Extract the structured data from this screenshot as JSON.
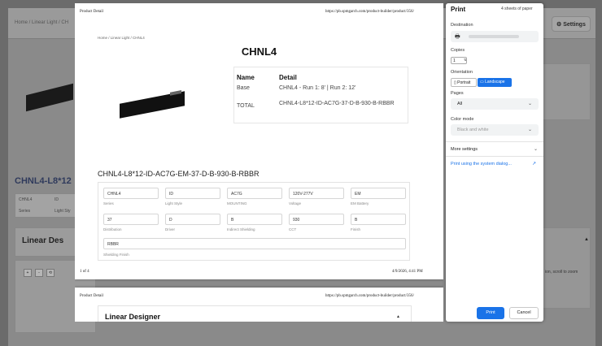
{
  "background": {
    "breadcrumb": "Home / Linear Light / CH",
    "settings_label": "Settings",
    "settings_icon": "gear-icon",
    "product_heading": "CHNL4-L8*12",
    "chips": [
      "CHNL4",
      "ID"
    ],
    "chip_labels": [
      "Series",
      "Light Sty"
    ],
    "section_title": "Linear Des",
    "hint_text": "ion, scroll to zoom",
    "frame_buttons": [
      "+",
      "-",
      "⟲"
    ]
  },
  "preview": {
    "page1": {
      "header_left": "Product Detail",
      "header_right": "https://pb.spmgarch.com/product-builder/product/356/",
      "breadcrumb": "Home / Linear Light / CHNL4",
      "title": "CHNL4",
      "table": {
        "headers": [
          "Name",
          "Detail"
        ],
        "rows": [
          {
            "name": "Base",
            "detail": "CHNL4 - Run 1: 8' | Run 2: 12'"
          },
          {
            "name": "TOTAL",
            "detail": "CHNL4-L8*12-ID-AC7G-37-D-B-930-B-RBBR"
          }
        ]
      },
      "sku": "CHNL4-L8*12-ID-AC7G-EM-37-D-B-930-B-RBBR",
      "form": {
        "row1": [
          {
            "value": "CHNL4",
            "label": "Series"
          },
          {
            "value": "ID",
            "label": "Light Style"
          },
          {
            "value": "AC7G",
            "label": "MOUNTING"
          },
          {
            "value": "120V-277V",
            "label": "Voltage"
          },
          {
            "value": "EM",
            "label": "EM Battery"
          }
        ],
        "row2": [
          {
            "value": "37",
            "label": "Distribution"
          },
          {
            "value": "D",
            "label": "Driver"
          },
          {
            "value": "B",
            "label": "Indirect Shielding"
          },
          {
            "value": "930",
            "label": "CCT"
          },
          {
            "value": "B",
            "label": "Finish"
          }
        ],
        "row3": {
          "value": "RBBR",
          "label": "Shielding Finish"
        }
      },
      "footer_left": "1 of 4",
      "footer_right": "4/9/2026, 4:41 PM"
    },
    "page2": {
      "header_left": "Product Detail",
      "header_right": "https://pb.spmgarch.com/product-builder/product/356/",
      "section_title": "Linear Designer",
      "caret": "▲"
    }
  },
  "dialog": {
    "title": "Print",
    "sheets": "4 sheets of paper",
    "destination_label": "Destination",
    "printer_icon": "printer-icon",
    "copies_label": "Copies",
    "copies_value": "1",
    "orientation_label": "Orientation",
    "portrait_label": "Portrait",
    "landscape_label": "Landscape",
    "pages_label": "Pages",
    "pages_value": "All",
    "color_label": "Color mode",
    "color_value": "Black and white",
    "more_settings": "More settings",
    "system_dialog_link": "Print using the system dialog...",
    "print_button": "Print",
    "cancel_button": "Cancel",
    "accent": "#1a73e8"
  }
}
